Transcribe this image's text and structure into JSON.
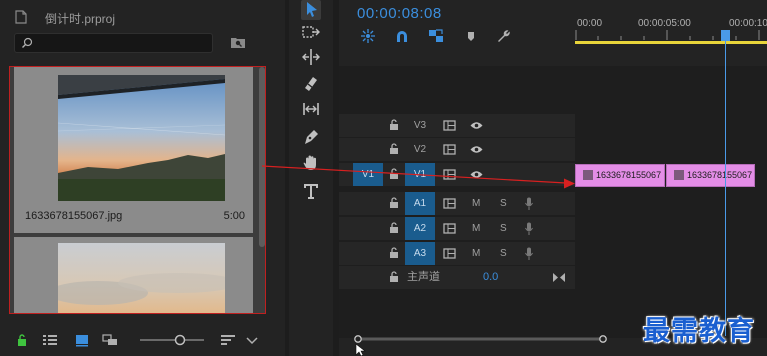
{
  "project": {
    "title": "倒计时.prproj",
    "clips": [
      {
        "name": "1633678155067.jpg",
        "duration": "5:00"
      }
    ]
  },
  "timeline": {
    "timecode": "00:00:08:08",
    "ruler": [
      "00:00",
      "00:00:05:00",
      "00:00:10"
    ],
    "source_patch": "V1",
    "tracks": [
      {
        "label": "V3",
        "kind": "video"
      },
      {
        "label": "V2",
        "kind": "video"
      },
      {
        "label": "V1",
        "kind": "video"
      },
      {
        "label": "A1",
        "kind": "audio"
      },
      {
        "label": "A2",
        "kind": "audio"
      },
      {
        "label": "A3",
        "kind": "audio"
      }
    ],
    "mute_label": "M",
    "solo_label": "S",
    "master": {
      "label": "主声道",
      "value": "0.0"
    },
    "clips": [
      {
        "label": "1633678155067"
      },
      {
        "label": "1633678155067"
      }
    ]
  },
  "watermark": "最需教育",
  "colors": {
    "accent": "#3b8edd",
    "selection_border": "#c02020",
    "clip_fill": "#e38de6",
    "work_area": "#e8d43a",
    "arrow": "#d82020"
  },
  "icons": {
    "tools": [
      "selection-tool-icon",
      "track-select-icon",
      "ripple-edit-icon",
      "razor-icon",
      "slip-icon",
      "pen-icon",
      "hand-icon",
      "type-icon"
    ]
  }
}
